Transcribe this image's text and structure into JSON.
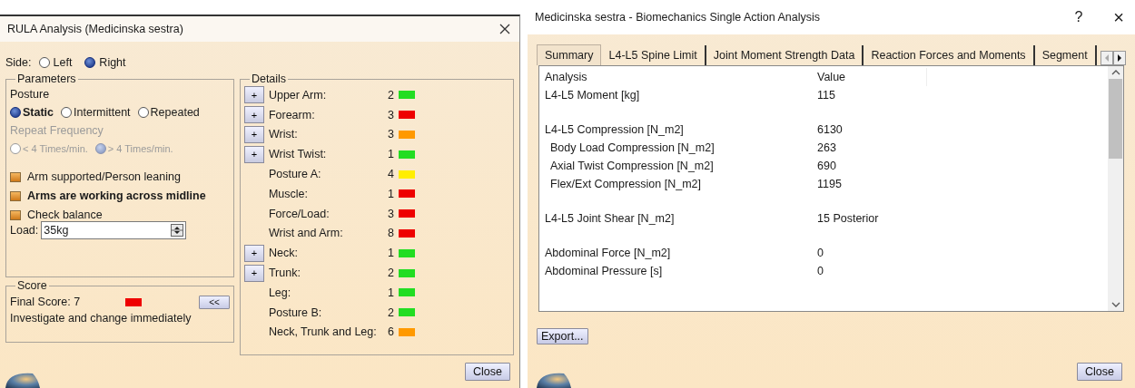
{
  "rula_window": {
    "title": "RULA Analysis (Medicinska sestra)",
    "side": {
      "label": "Side:",
      "options": [
        {
          "label": "Left",
          "selected": false
        },
        {
          "label": "Right",
          "selected": true
        }
      ]
    },
    "parameters": {
      "title": "Parameters",
      "posture_label": "Posture",
      "posture_options": [
        {
          "label": "Static",
          "selected": true
        },
        {
          "label": "Intermittent",
          "selected": false
        },
        {
          "label": "Repeated",
          "selected": false
        }
      ],
      "repeat_label": "Repeat Frequency",
      "repeat_disabled": true,
      "repeat_options": [
        {
          "label": "< 4 Times/min.",
          "selected": false
        },
        {
          "label": "> 4 Times/min.",
          "selected": true
        }
      ],
      "checkboxes": [
        {
          "label": "Arm supported/Person leaning",
          "checked": true,
          "bold": false
        },
        {
          "label": "Arms are working across midline",
          "checked": true,
          "bold": true
        },
        {
          "label": "Check balance",
          "checked": true,
          "bold": false
        }
      ],
      "load_label": "Load:",
      "load_value": "35kg"
    },
    "score": {
      "title": "Score",
      "label": "Final Score: 7",
      "color": "#ee0000",
      "collapse_button": "<<",
      "message": "Investigate and change immediately"
    },
    "details": {
      "title": "Details",
      "items": [
        {
          "expand_button": "+",
          "label": "Upper Arm:",
          "value": "2",
          "color": "#22dd22"
        },
        {
          "expand_button": "+",
          "label": "Forearm:",
          "value": "3",
          "color": "#ee0000"
        },
        {
          "expand_button": "+",
          "label": "Wrist:",
          "value": "3",
          "color": "#ff9900"
        },
        {
          "expand_button": "+",
          "label": "Wrist Twist:",
          "value": "1",
          "color": "#22dd22"
        },
        {
          "label": "Posture A:",
          "value": "4",
          "color": "#ffee00"
        },
        {
          "label": "Muscle:",
          "value": "1",
          "color": "#ee0000"
        },
        {
          "label": "Force/Load:",
          "value": "3",
          "color": "#ee0000"
        },
        {
          "label": "Wrist and Arm:",
          "value": "8",
          "color": "#ee0000"
        },
        {
          "expand_button": "+",
          "label": "Neck:",
          "value": "1",
          "color": "#22dd22"
        },
        {
          "expand_button": "+",
          "label": "Trunk:",
          "value": "2",
          "color": "#22dd22"
        },
        {
          "label": "Leg:",
          "value": "1",
          "color": "#22dd22"
        },
        {
          "label": "Posture B:",
          "value": "2",
          "color": "#22dd22"
        },
        {
          "label": "Neck, Trunk and Leg:",
          "value": "6",
          "color": "#ff9900"
        }
      ]
    },
    "close_button": "Close"
  },
  "biomechanics_window": {
    "title": "Medicinska sestra - Biomechanics Single Action Analysis",
    "help_button": "?",
    "close_icon": "×",
    "tabs": [
      {
        "label": "Summary",
        "selected": true
      },
      {
        "label": "L4-L5 Spine Limit",
        "selected": false
      },
      {
        "label": "Joint Moment Strength Data",
        "selected": false
      },
      {
        "label": "Reaction Forces and Moments",
        "selected": false
      },
      {
        "label": "Segment",
        "selected": false
      }
    ],
    "table": {
      "columns": [
        "Analysis",
        "Value"
      ],
      "groups": [
        [
          {
            "name": "L4-L5 Moment [kg]",
            "value": "115"
          }
        ],
        [
          {
            "name": "L4-L5 Compression [N_m2]",
            "value": "6130",
            "children": [
              {
                "name": "Body Load Compression [N_m2]",
                "value": "263"
              },
              {
                "name": "Axial Twist Compression [N_m2]",
                "value": "690"
              },
              {
                "name": "Flex/Ext Compression [N_m2]",
                "value": "1195"
              }
            ]
          }
        ],
        [
          {
            "name": "L4-L5 Joint Shear [N_m2]",
            "value": "15  Posterior"
          }
        ],
        [
          {
            "name": "Abdominal Force [N_m2]",
            "value": "0"
          },
          {
            "name": "Abdominal Pressure [s]",
            "value": "0"
          }
        ]
      ]
    },
    "export_button": "Export...",
    "close_button": "Close"
  }
}
